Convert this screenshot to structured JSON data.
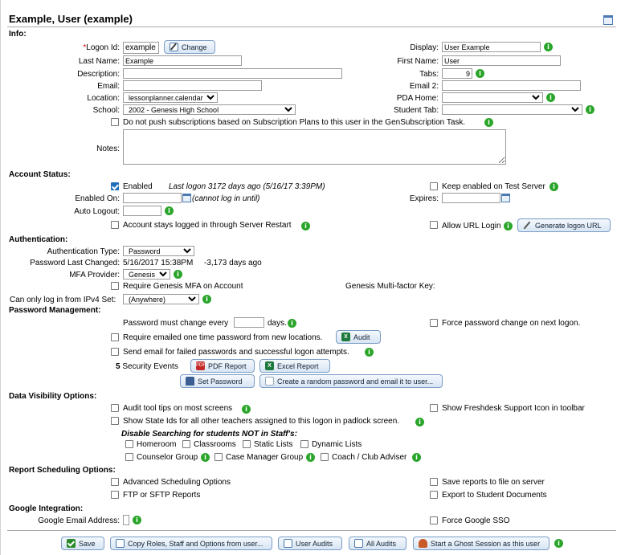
{
  "header": {
    "title": "Example, User (example)",
    "calendar_icon": "calendar-icon"
  },
  "sections": {
    "info": "Info:",
    "account_status": "Account Status:",
    "authentication": "Authentication:",
    "password_management": "Password Management:",
    "data_visibility": "Data Visibility Options:",
    "report_scheduling": "Report Scheduling Options:",
    "google": "Google Integration:"
  },
  "info": {
    "logon_required_mark": "*",
    "logon_label": "Logon Id:",
    "logon_value": "example",
    "change_button": "Change",
    "last_name_label": "Last Name:",
    "last_name_value": "Example",
    "description_label": "Description:",
    "description_value": "",
    "email_label": "Email:",
    "email_value": "",
    "location_label": "Location:",
    "location_value": "lessonplanner.calendar",
    "school_label": "School:",
    "school_value": "2002 - Genesis High School",
    "display_label": "Display:",
    "display_value": "User Example",
    "first_name_label": "First Name:",
    "first_name_value": "User",
    "tabs_label": "Tabs:",
    "tabs_value": "9",
    "email2_label": "Email 2:",
    "email2_value": "",
    "pda_home_label": "PDA Home:",
    "pda_home_value": "",
    "student_tab_label": "Student Tab:",
    "student_tab_value": "",
    "no_push_label": "Do not push subscriptions based on Subscription Plans to this user in the GenSubscription Task.",
    "notes_label": "Notes:",
    "notes_value": ""
  },
  "account": {
    "enabled_label": "Enabled",
    "last_logon": "Last logon 3172 days ago (5/16/17 3:39PM)",
    "keep_enabled_label": "Keep enabled on Test Server",
    "enabled_on_label": "Enabled On:",
    "enabled_on_value": "",
    "cannot_login": "(cannot log in until)",
    "expires_label": "Expires:",
    "expires_value": "",
    "auto_logout_label": "Auto Logout:",
    "auto_logout_value": "",
    "stays_logged_label": "Account stays logged in through Server Restart",
    "allow_url_label": "Allow URL Login",
    "generate_url_button": "Generate logon URL"
  },
  "auth": {
    "type_label": "Authentication Type:",
    "type_value": "Password",
    "pw_changed_label": "Password Last Changed:",
    "pw_changed_value": "5/16/2017 15:38PM",
    "pw_changed_days": "-3,173 days ago",
    "mfa_label": "MFA Provider:",
    "mfa_value": "Genesis",
    "require_mfa_label": "Require Genesis MFA on Account",
    "mfa_key_label": "Genesis Multi-factor Key:",
    "ipv4_label": "Can only log in from IPv4 Set:",
    "ipv4_value": "(Anywhere)"
  },
  "pwmgmt": {
    "must_change_label": "Password must change every",
    "must_change_value": "",
    "days_label": "days.",
    "force_change_label": "Force password change on next logon.",
    "require_emailed_label": "Require emailed one time password from new locations.",
    "audit_button": "Audit",
    "send_email_label": "Send email for failed passwords and successful logon attempts.",
    "security_count": "5",
    "security_events_label": "Security Events",
    "pdf_button": "PDF Report",
    "excel_button": "Excel Report",
    "set_password_button": "Set Password",
    "random_password_button": "Create a random password and email it to user..."
  },
  "visibility": {
    "audit_tips_label": "Audit tool tips on most screens",
    "freshdesk_label": "Show Freshdesk Support Icon in toolbar",
    "state_ids_label": "Show State Ids for all other teachers assigned to this logon in padlock screen.",
    "disable_search_label": "Disable Searching for students NOT in Staff's:",
    "homeroom": "Homeroom",
    "classrooms": "Classrooms",
    "static_lists": "Static Lists",
    "dynamic_lists": "Dynamic Lists",
    "counselor_group": "Counselor Group",
    "case_manager_group": "Case Manager Group",
    "coach_adviser": "Coach / Club Adviser"
  },
  "reports": {
    "advanced_label": "Advanced Scheduling Options",
    "save_reports_label": "Save reports to file on server",
    "ftp_label": "FTP or SFTP Reports",
    "export_docs_label": "Export to Student Documents"
  },
  "google": {
    "email_label": "Google Email Address:",
    "email_value": "",
    "force_sso_label": "Force Google SSO"
  },
  "footer": {
    "save": "Save",
    "copy_roles": "Copy Roles, Staff and Options from user...",
    "user_audits": "User Audits",
    "all_audits": "All Audits",
    "ghost_session": "Start a Ghost Session as this user"
  },
  "colors": {
    "info_icon": "#2aa52a",
    "checkbox_checked": "#1f6fb8",
    "button_border": "#7a9cc6",
    "required_mark": "#dd0000"
  }
}
